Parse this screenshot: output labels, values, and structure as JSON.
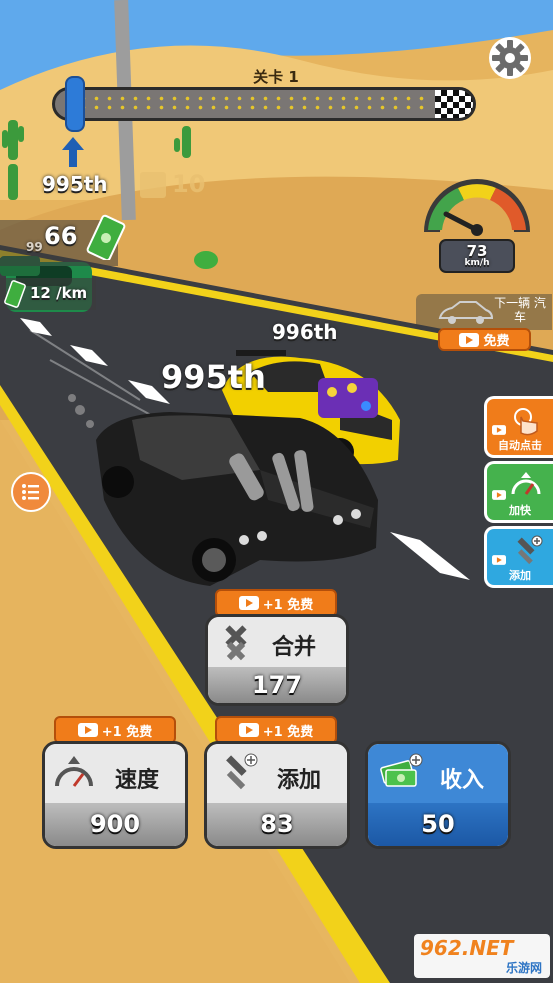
{
  "level": {
    "title": "关卡 1"
  },
  "hud": {
    "rank_top": "995th",
    "money": "66",
    "money_partial": "99",
    "speed": "12 /km",
    "rank_player": "995th",
    "rank_opponent": "996th",
    "ghost_number": "10"
  },
  "speedometer": {
    "value": "73",
    "unit": "km/h"
  },
  "next_car": {
    "label": "下一辆 汽车",
    "free_button": "免费"
  },
  "side_buttons": [
    {
      "label": "自动点击",
      "icon": "tap-icon"
    },
    {
      "label": "加快",
      "icon": "speed-icon"
    },
    {
      "label": "添加",
      "icon": "hammer-plus-icon"
    }
  ],
  "cards": {
    "merge": {
      "label": "合并",
      "value": "177",
      "free": "+1 免费"
    },
    "speed": {
      "label": "速度",
      "value": "900",
      "free": "+1 免费"
    },
    "add": {
      "label": "添加",
      "value": "83",
      "free": "+1 免费"
    },
    "income": {
      "label": "收入",
      "value": "50"
    }
  },
  "watermark": {
    "text": "962.NET",
    "sub": "乐游网"
  },
  "colors": {
    "accent": "#f07c1a",
    "blue_card": "#2d74c4",
    "road": "#3b3d42"
  }
}
